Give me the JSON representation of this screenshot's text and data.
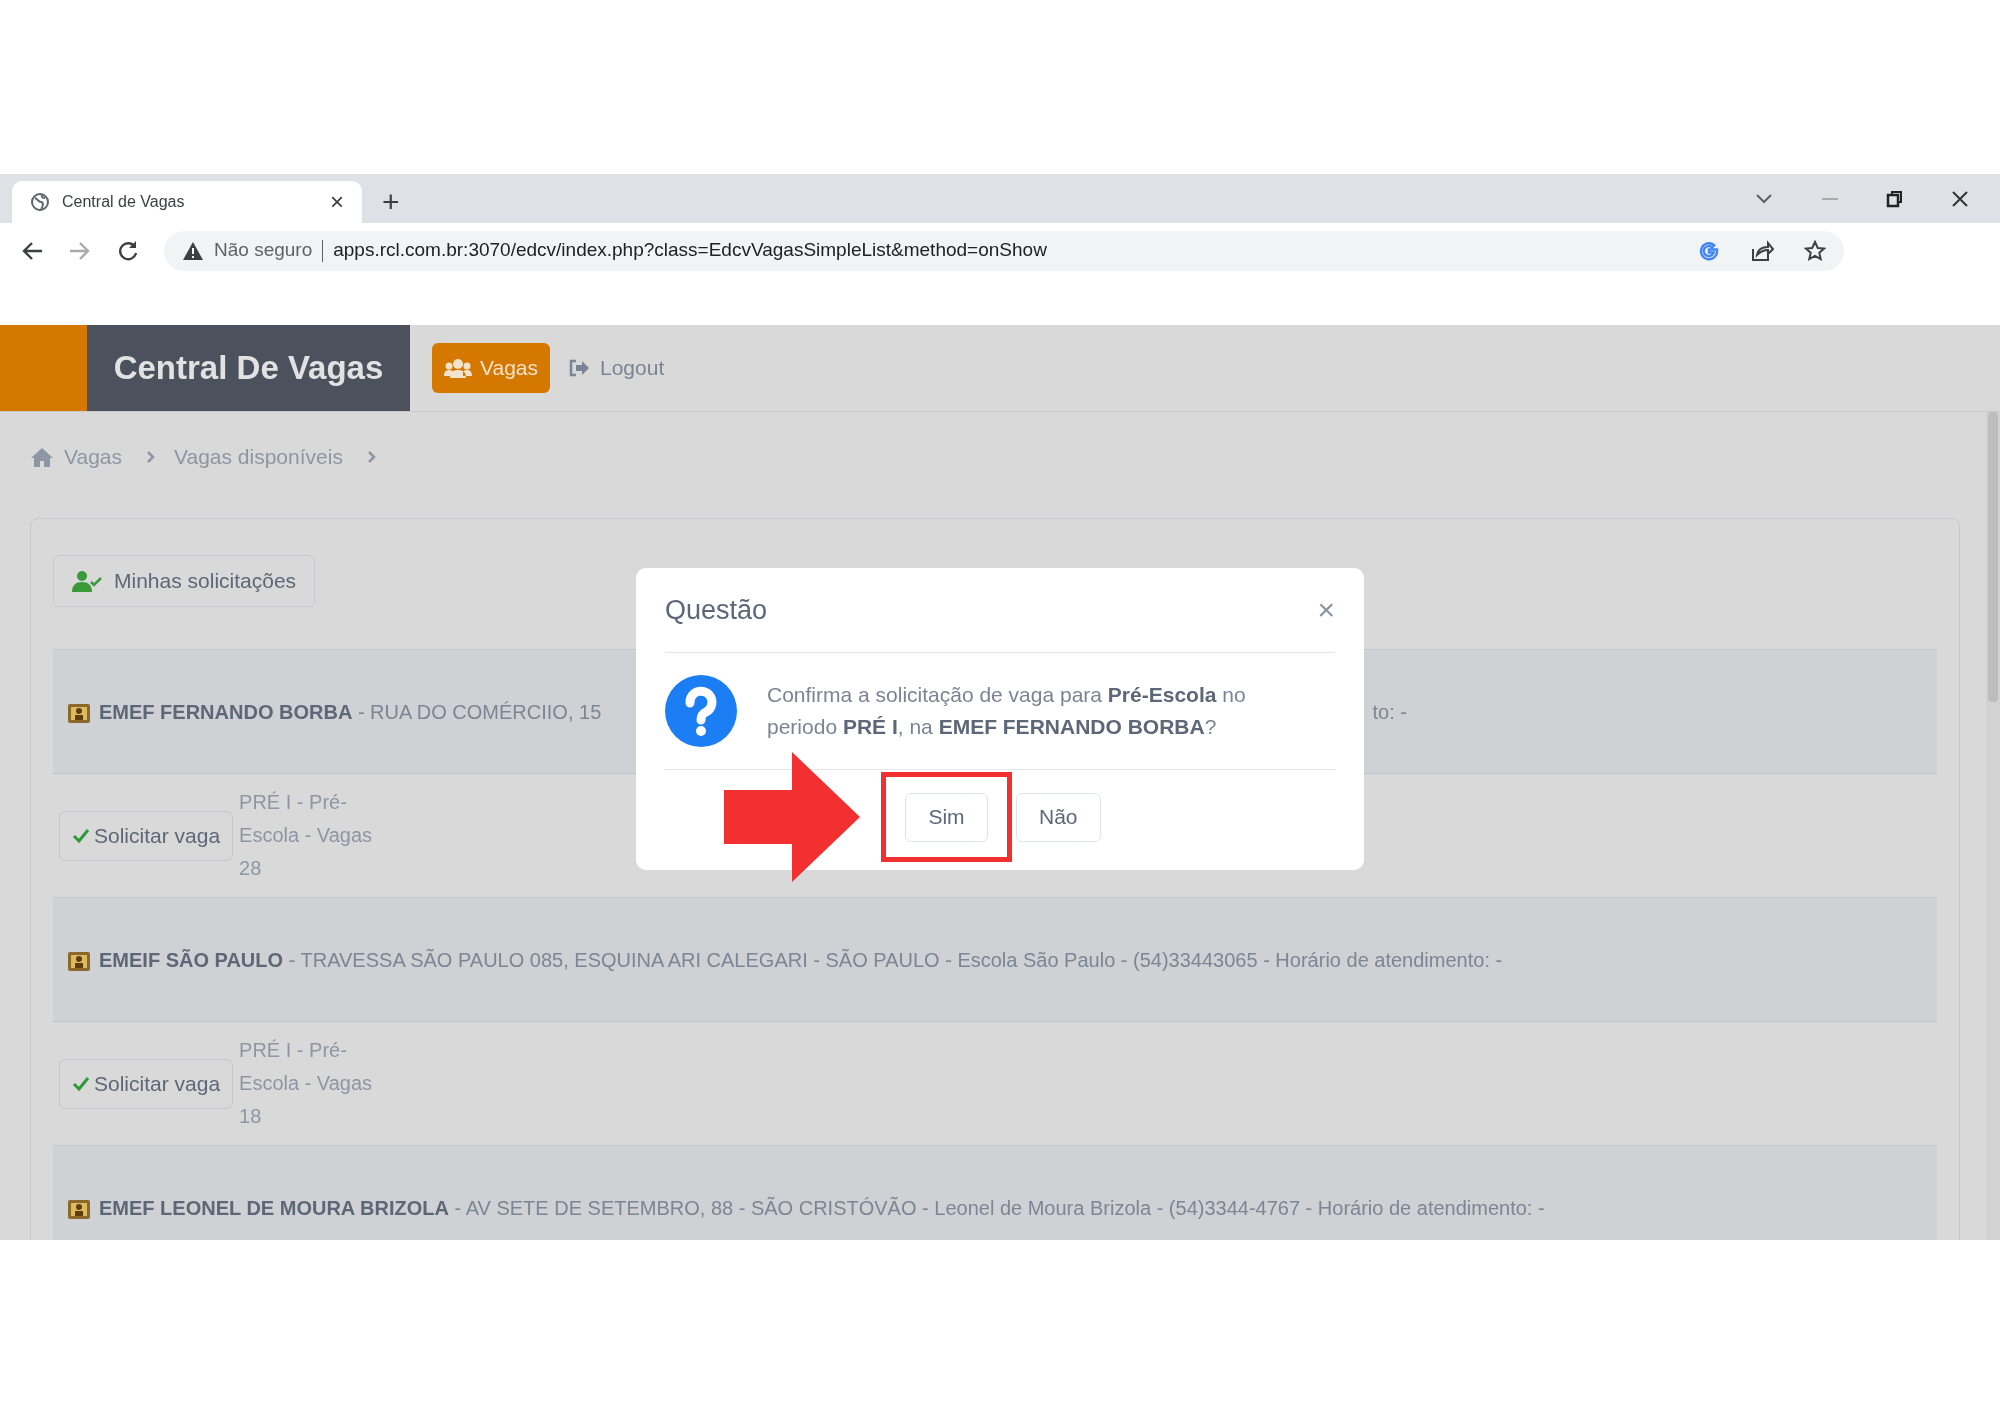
{
  "browser": {
    "tab_title": "Central de Vagas",
    "tab_close": "×",
    "new_tab": "+",
    "security": "Não seguro",
    "url": "apps.rcl.com.br:3070/edcv/index.php?class=EdcvVagasSimpleList&method=onShow"
  },
  "app": {
    "brand": "Central De Vagas",
    "nav": [
      {
        "label": "Vagas",
        "selected": true
      },
      {
        "label": "Logout",
        "selected": false
      }
    ]
  },
  "breadcrumb": [
    "Vagas",
    "Vagas disponíveis"
  ],
  "my_requests_button": "Minhas solicitações",
  "schools": [
    {
      "header": "**EMEF FERNANDO BORBA** - RUA DO COMÉRCIIO, 15",
      "header_tail": "to: -",
      "button": "Solicitar vaga",
      "info": "PRÉ I - Pré-Escola - Vagas 28"
    },
    {
      "header": "**EMEIF SÃO PAULO** - TRAVESSA SÃO PAULO 085, ESQUINA ARI CALEGARI - SÃO PAULO - Escola São Paulo - (54)33443065 - Horário de atendimento: -",
      "button": "Solicitar vaga",
      "info": "PRÉ I - Pré-Escola - Vagas 18"
    },
    {
      "header": "**EMEF LEONEL DE MOURA BRIZOLA** - AV SETE DE SETEMBRO, 88 - SÃO CRISTÓVÃO - Leonel de Moura Brizola - (54)3344-4767 - Horário de atendimento: -"
    }
  ],
  "dialog": {
    "title": "Questão",
    "close": "×",
    "message": "Confirma a solicitação de vaga para **Pré-Escola** no periodo **PRÉ I**, na **EMEF FERNANDO BORBA**?",
    "buttons": [
      {
        "label": "Sim",
        "highlighted": true
      },
      {
        "label": "Não",
        "highlighted": false
      }
    ]
  }
}
